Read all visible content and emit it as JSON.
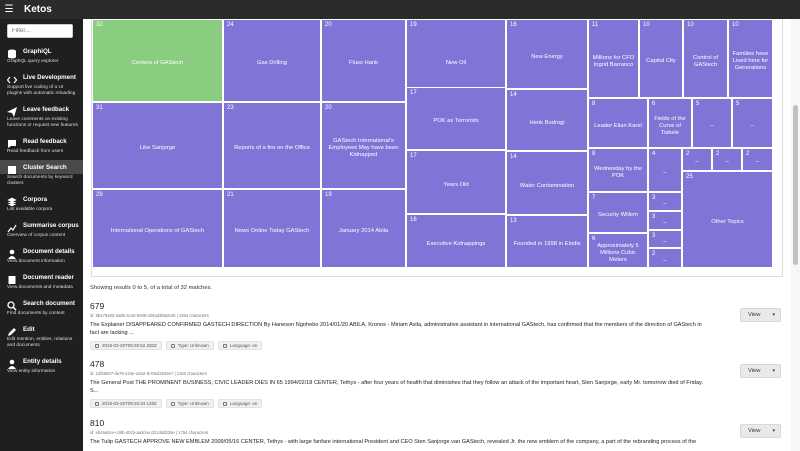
{
  "app": {
    "title": "Ketos"
  },
  "sidebar": {
    "filter_placeholder": "Filter...",
    "items": [
      {
        "label": "GraphiQL",
        "desc": "GraphQL query explorer",
        "icon": "database-icon"
      },
      {
        "label": "Live Development",
        "desc": "Support live coding of a UI plugins with automatic reloading",
        "icon": "code-icon"
      },
      {
        "label": "Leave feedback",
        "desc": "Leave comments on existing functions or request new features",
        "icon": "send-icon"
      },
      {
        "label": "Read feedback",
        "desc": "Read feedback from users",
        "icon": "comment-icon"
      },
      {
        "label": "Cluster Search",
        "desc": "Search documents by keyword clusters",
        "icon": "cluster-icon"
      },
      {
        "label": "Corpora",
        "desc": "List available corpora",
        "icon": "stack-icon"
      },
      {
        "label": "Summarise corpus",
        "desc": "Overview of corpus content",
        "icon": "chart-icon"
      },
      {
        "label": "Document details",
        "desc": "View document information",
        "icon": "user-icon"
      },
      {
        "label": "Document reader",
        "desc": "View documents and metadata",
        "icon": "reader-icon"
      },
      {
        "label": "Search document",
        "desc": "Find documents by content",
        "icon": "search-icon"
      },
      {
        "label": "Edit",
        "desc": "Edit mention, entities, relations and documents",
        "icon": "pencil-icon"
      },
      {
        "label": "Entity details",
        "desc": "View entity information",
        "icon": "user-icon"
      }
    ]
  },
  "treemap": {
    "cells": [
      {
        "count": "32",
        "label": "Centers of GAStech",
        "highlight": true
      },
      {
        "count": "24",
        "label": "Gas Drilling"
      },
      {
        "count": "20",
        "label": "Fluss Hank"
      },
      {
        "count": "19",
        "label": "New Oil"
      },
      {
        "count": "16",
        "label": "New Energy"
      },
      {
        "count": "11",
        "label": "Millions for CFO Ingrid Barranco"
      },
      {
        "count": "10",
        "label": "Capital City"
      },
      {
        "count": "10",
        "label": "Control of GAStech"
      },
      {
        "count": "10",
        "label": "Families have Lived here for Generations"
      },
      {
        "count": "31",
        "label": "Like Sanjorge"
      },
      {
        "count": "23",
        "label": "Reports of a fire on the Office"
      },
      {
        "count": "20",
        "label": "GAStech International's Employees May have been Kidnapped"
      },
      {
        "count": "17",
        "label": "POK as Terrorists"
      },
      {
        "count": "14",
        "label": "Henk Bodrogi"
      },
      {
        "count": "8",
        "label": "Leader Elian Karel"
      },
      {
        "count": "6",
        "label": "Fields of the Curve of Tiskele"
      },
      {
        "count": "5",
        "label": "--"
      },
      {
        "count": "5",
        "label": "--"
      },
      {
        "count": "17",
        "label": "Years Old"
      },
      {
        "count": "14",
        "label": "Water Contamination"
      },
      {
        "count": "8",
        "label": "Wednesday by the POK"
      },
      {
        "count": "4",
        "label": "--"
      },
      {
        "count": "2",
        "label": "--"
      },
      {
        "count": "2",
        "label": "--"
      },
      {
        "count": "2",
        "label": "--"
      },
      {
        "count": "3",
        "label": "--"
      },
      {
        "count": "28",
        "label": "International Operations of GAStech"
      },
      {
        "count": "21",
        "label": "News Online Today GAStech"
      },
      {
        "count": "19",
        "label": "January 2014 Abila"
      },
      {
        "count": "16",
        "label": "Executive Kidnappings"
      },
      {
        "count": "13",
        "label": "Founded in 1998 in Elodis"
      },
      {
        "count": "7",
        "label": "Security Willem"
      },
      {
        "count": "25",
        "label": "Other Topics"
      },
      {
        "count": "3",
        "label": "--"
      },
      {
        "count": "3",
        "label": "--"
      },
      {
        "count": "6",
        "label": "Approximately 5 Millions Cubic Meters"
      },
      {
        "count": "2",
        "label": "--"
      }
    ]
  },
  "results": {
    "info": "Showing results 0 to 5, of a total of 32 matches.",
    "view_label": "View",
    "docs": [
      {
        "id": "679",
        "meta": "id: 8b47948d-da8b-4c40-9299-426ad3b6de28 | 1594 characters",
        "text": "The Explainer DISAPPEARED CONFIRMED GASTECH DIRECTION By Haneson Ngohebo 2014/01/20  ABILA, Kronos - Miriam Avila, administrative assistant in international GAStech, has confirmed that the members of the direction of GAStech in fact are lacking ...",
        "date": "2018-03-26T09:26:52.330Z",
        "type": "Type: Unknown",
        "lang": "Language: en"
      },
      {
        "id": "478",
        "meta": "id: 12f66b07-da79-424e-a3a2-fe78ed2538e7 | 1260 characters",
        "text": "The General Post THE PROMINENT BUSINESS, CIVIC LEADER DIES IN 65  1994/02/18  CENTER, Tethys - after four years of health that diminishes that they follow an attack of the important heart, Sten Sanjorge, early Mr. tomorrow died of Friday. S...",
        "date": "2018-03-26T09:26:34.128Z",
        "type": "Type: Unknown",
        "lang": "Language: en"
      },
      {
        "id": "810",
        "meta": "id: eb46a0ce-c49b-40cb-aa2d-ecd3145d335e | 1754 characters",
        "text": "The Tulip GASTECH APPROVE NEW EMBLEM  2009/05/16  CENTER, Tethys - with large fanfare international President and CEO Sten Sanjorge van GAStech, revealed Jr. the new emblem of the company, a part of the rebranding process of the",
        "date": "",
        "type": "",
        "lang": ""
      }
    ]
  }
}
